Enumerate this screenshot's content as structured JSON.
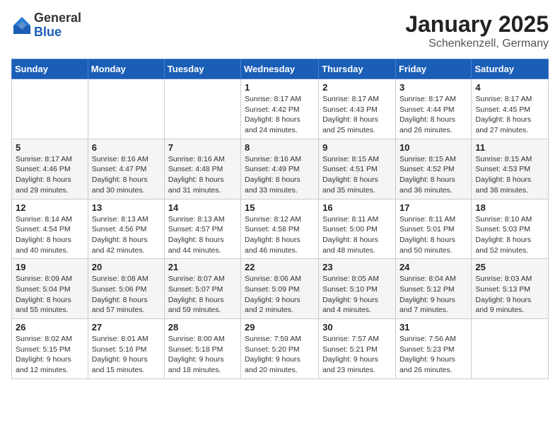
{
  "header": {
    "logo_general": "General",
    "logo_blue": "Blue",
    "month_title": "January 2025",
    "location": "Schenkenzell, Germany"
  },
  "weekdays": [
    "Sunday",
    "Monday",
    "Tuesday",
    "Wednesday",
    "Thursday",
    "Friday",
    "Saturday"
  ],
  "weeks": [
    [
      {
        "day": "",
        "info": ""
      },
      {
        "day": "",
        "info": ""
      },
      {
        "day": "",
        "info": ""
      },
      {
        "day": "1",
        "info": "Sunrise: 8:17 AM\nSunset: 4:42 PM\nDaylight: 8 hours\nand 24 minutes."
      },
      {
        "day": "2",
        "info": "Sunrise: 8:17 AM\nSunset: 4:43 PM\nDaylight: 8 hours\nand 25 minutes."
      },
      {
        "day": "3",
        "info": "Sunrise: 8:17 AM\nSunset: 4:44 PM\nDaylight: 8 hours\nand 26 minutes."
      },
      {
        "day": "4",
        "info": "Sunrise: 8:17 AM\nSunset: 4:45 PM\nDaylight: 8 hours\nand 27 minutes."
      }
    ],
    [
      {
        "day": "5",
        "info": "Sunrise: 8:17 AM\nSunset: 4:46 PM\nDaylight: 8 hours\nand 29 minutes."
      },
      {
        "day": "6",
        "info": "Sunrise: 8:16 AM\nSunset: 4:47 PM\nDaylight: 8 hours\nand 30 minutes."
      },
      {
        "day": "7",
        "info": "Sunrise: 8:16 AM\nSunset: 4:48 PM\nDaylight: 8 hours\nand 31 minutes."
      },
      {
        "day": "8",
        "info": "Sunrise: 8:16 AM\nSunset: 4:49 PM\nDaylight: 8 hours\nand 33 minutes."
      },
      {
        "day": "9",
        "info": "Sunrise: 8:15 AM\nSunset: 4:51 PM\nDaylight: 8 hours\nand 35 minutes."
      },
      {
        "day": "10",
        "info": "Sunrise: 8:15 AM\nSunset: 4:52 PM\nDaylight: 8 hours\nand 36 minutes."
      },
      {
        "day": "11",
        "info": "Sunrise: 8:15 AM\nSunset: 4:53 PM\nDaylight: 8 hours\nand 38 minutes."
      }
    ],
    [
      {
        "day": "12",
        "info": "Sunrise: 8:14 AM\nSunset: 4:54 PM\nDaylight: 8 hours\nand 40 minutes."
      },
      {
        "day": "13",
        "info": "Sunrise: 8:13 AM\nSunset: 4:56 PM\nDaylight: 8 hours\nand 42 minutes."
      },
      {
        "day": "14",
        "info": "Sunrise: 8:13 AM\nSunset: 4:57 PM\nDaylight: 8 hours\nand 44 minutes."
      },
      {
        "day": "15",
        "info": "Sunrise: 8:12 AM\nSunset: 4:58 PM\nDaylight: 8 hours\nand 46 minutes."
      },
      {
        "day": "16",
        "info": "Sunrise: 8:11 AM\nSunset: 5:00 PM\nDaylight: 8 hours\nand 48 minutes."
      },
      {
        "day": "17",
        "info": "Sunrise: 8:11 AM\nSunset: 5:01 PM\nDaylight: 8 hours\nand 50 minutes."
      },
      {
        "day": "18",
        "info": "Sunrise: 8:10 AM\nSunset: 5:03 PM\nDaylight: 8 hours\nand 52 minutes."
      }
    ],
    [
      {
        "day": "19",
        "info": "Sunrise: 8:09 AM\nSunset: 5:04 PM\nDaylight: 8 hours\nand 55 minutes."
      },
      {
        "day": "20",
        "info": "Sunrise: 8:08 AM\nSunset: 5:06 PM\nDaylight: 8 hours\nand 57 minutes."
      },
      {
        "day": "21",
        "info": "Sunrise: 8:07 AM\nSunset: 5:07 PM\nDaylight: 8 hours\nand 59 minutes."
      },
      {
        "day": "22",
        "info": "Sunrise: 8:06 AM\nSunset: 5:09 PM\nDaylight: 9 hours\nand 2 minutes."
      },
      {
        "day": "23",
        "info": "Sunrise: 8:05 AM\nSunset: 5:10 PM\nDaylight: 9 hours\nand 4 minutes."
      },
      {
        "day": "24",
        "info": "Sunrise: 8:04 AM\nSunset: 5:12 PM\nDaylight: 9 hours\nand 7 minutes."
      },
      {
        "day": "25",
        "info": "Sunrise: 8:03 AM\nSunset: 5:13 PM\nDaylight: 9 hours\nand 9 minutes."
      }
    ],
    [
      {
        "day": "26",
        "info": "Sunrise: 8:02 AM\nSunset: 5:15 PM\nDaylight: 9 hours\nand 12 minutes."
      },
      {
        "day": "27",
        "info": "Sunrise: 8:01 AM\nSunset: 5:16 PM\nDaylight: 9 hours\nand 15 minutes."
      },
      {
        "day": "28",
        "info": "Sunrise: 8:00 AM\nSunset: 5:18 PM\nDaylight: 9 hours\nand 18 minutes."
      },
      {
        "day": "29",
        "info": "Sunrise: 7:59 AM\nSunset: 5:20 PM\nDaylight: 9 hours\nand 20 minutes."
      },
      {
        "day": "30",
        "info": "Sunrise: 7:57 AM\nSunset: 5:21 PM\nDaylight: 9 hours\nand 23 minutes."
      },
      {
        "day": "31",
        "info": "Sunrise: 7:56 AM\nSunset: 5:23 PM\nDaylight: 9 hours\nand 26 minutes."
      },
      {
        "day": "",
        "info": ""
      }
    ]
  ]
}
